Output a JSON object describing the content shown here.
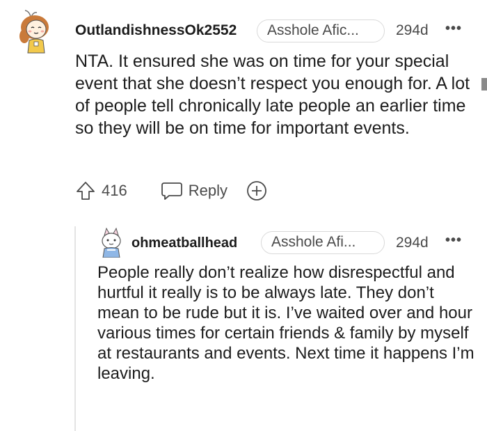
{
  "comment": {
    "username": "OutlandishnessOk2552",
    "flair": "Asshole Afic...",
    "age": "294d",
    "more": "•••",
    "body": "NTA. It ensured she was on time for your special event that she doesn’t respect you enough for. A lot of people tell chronically late people an earlier time so they will be on time for important events.",
    "actions": {
      "upvotes": "416",
      "reply_label": "Reply"
    },
    "reply": {
      "username": "ohmeatballhead",
      "flair": "Asshole Afi...",
      "age": "294d",
      "more": "•••",
      "body": "People really don’t realize how disrespectful and hurtful it really is to be always late. They don’t mean to be rude but it is. I’ve waited over and hour various times for certain friends & family by myself at restaurants and events. Next time it happens I’m leaving."
    }
  },
  "icons": {
    "avatar": "avatar-icon",
    "upvote": "upvote-arrow-icon",
    "reply": "speech-bubble-icon",
    "award": "plus-circle-icon",
    "more": "more-dots-icon"
  },
  "colors": {
    "text": "#1c1c1c",
    "meta": "#4a4a4a",
    "border": "#d9d9d9"
  }
}
